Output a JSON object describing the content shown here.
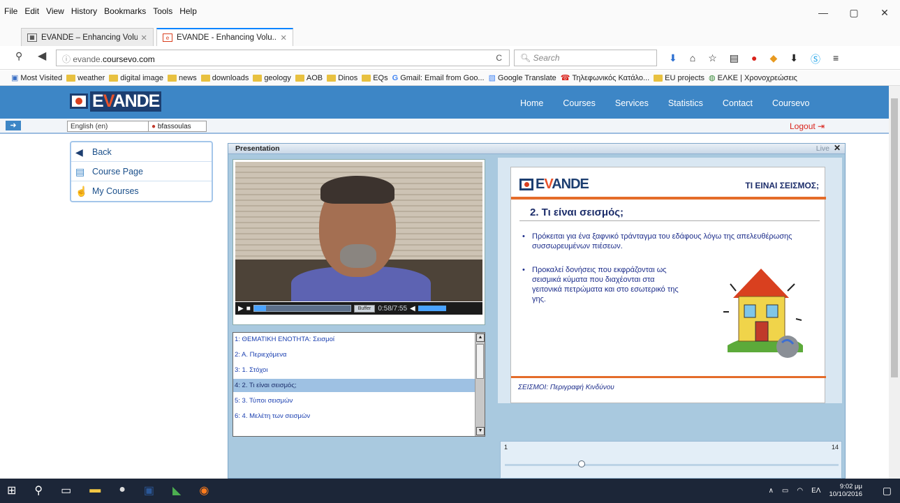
{
  "browser": {
    "menus": [
      "File",
      "Edit",
      "View",
      "History",
      "Bookmarks",
      "Tools",
      "Help"
    ],
    "window_controls": [
      "—",
      "▢",
      "✕"
    ],
    "tabs": [
      {
        "title": "EVANDE – Enhancing Volu...",
        "close": "✕",
        "icon": "grid-icon"
      },
      {
        "title": "EVANDE - Enhancing Volu...",
        "close": "✕",
        "icon": "evande-favicon"
      }
    ],
    "new_tab": "+",
    "url_prefix": "evande.",
    "url_domain": "coursevo.com",
    "reload": "C",
    "search_placeholder": "Search",
    "bookmarks": [
      "Most Visited",
      "weather",
      "digital image",
      "news",
      "downloads",
      "geology",
      "AOB",
      "Dinos",
      "EQs",
      "Gmail: Email from Goo...",
      "Google Translate",
      "Τηλεφωνικός Κατάλο...",
      "EU projects",
      "ΕΛΚΕ | Χρονοχρεώσεις"
    ]
  },
  "site": {
    "logo_prefix": "E",
    "logo_accent": "V",
    "logo_suffix": "ANDE",
    "nav": [
      "Home",
      "Courses",
      "Services",
      "Statistics",
      "Contact",
      "Coursevo"
    ],
    "language": "English (en)",
    "user": "bfassoulas",
    "logout": "Logout"
  },
  "leftmenu": {
    "back": "Back",
    "course_page": "Course Page",
    "my_courses": "My Courses"
  },
  "presentation": {
    "title": "Presentation",
    "live": "Live",
    "close": "✕",
    "video": {
      "buffer": "Buffer",
      "time": "0:58/7:55",
      "progress": 0.12
    },
    "toc": [
      "1: ΘΕΜΑΤΙΚΗ ΕΝΟΤΗΤΑ: Σεισμοί",
      "2: Α. Περιεχόμενα",
      "3: 1. Στόχοι",
      "4: 2. Τι είναι σεισμός;",
      "5: 3. Τύποι σεισμών",
      "6: 4. Μελέτη των σεισμών"
    ],
    "toc_selected": 3,
    "slide": {
      "logo_prefix": "E",
      "logo_accent": "V",
      "logo_suffix": "ANDE",
      "header": "ΤΙ ΕΙΝΑΙ ΣΕΙΣΜΟΣ;",
      "title": "2. Τι είναι σεισμός;",
      "bullet1": "Πρόκειται για ένα ξαφνικό τράνταγμα του εδάφους λόγω της απελευθέρωσης συσσωρευμένων πιέσεων.",
      "bullet2": "Προκαλεί δονήσεις που εκφράζονται ως σεισμικά κύματα που διαχέονται στα γειτονικά πετρώματα και στο εσωτερικό της γης.",
      "footer": "ΣΕΙΣΜΟΙ: Περιγραφή Κινδύνου"
    },
    "pager": {
      "first": "1",
      "last": "14",
      "current": 4
    }
  },
  "taskbar": {
    "lang": "ΕΛ",
    "time": "9:02 μμ",
    "date": "10/10/2016"
  }
}
